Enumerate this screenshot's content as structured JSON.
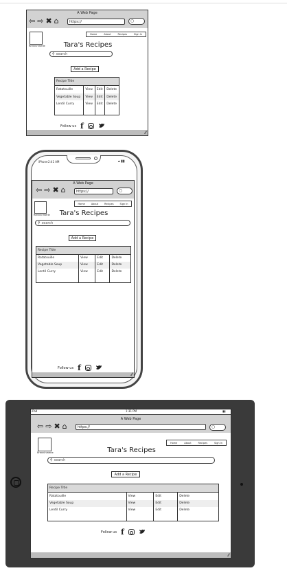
{
  "browser": {
    "window_title": "A Web Page",
    "url": "https://",
    "nav_icons": [
      "back-arrow-icon",
      "forward-arrow-icon",
      "close-icon",
      "home-icon"
    ]
  },
  "page": {
    "brand": "Rrenninmerle",
    "menu": [
      "Home",
      "About",
      "Recipes",
      "Sign In"
    ],
    "title": "Tara's Recipes",
    "search_placeholder": "search",
    "add_button": "Add a Recipe",
    "table": {
      "header": "Recipe Title",
      "rows": [
        {
          "title": "Ratatouille",
          "view": "View",
          "edit": "Edit",
          "delete": "Delete"
        },
        {
          "title": "Vegetable Soup",
          "view": "View",
          "edit": "Edit",
          "delete": "Delete"
        },
        {
          "title": "Lentil Curry",
          "view": "View",
          "edit": "Edit",
          "delete": "Delete"
        }
      ]
    },
    "follow_label": "Follow us"
  },
  "phone": {
    "carrier": "iPhone",
    "time": "2:41 AM"
  },
  "tablet": {
    "left_status": "iPad",
    "time": "1:31 PM"
  },
  "colors": {
    "chrome_gray": "#d2d2d2",
    "device_dark": "#3a3a3a",
    "outline": "#333333"
  }
}
